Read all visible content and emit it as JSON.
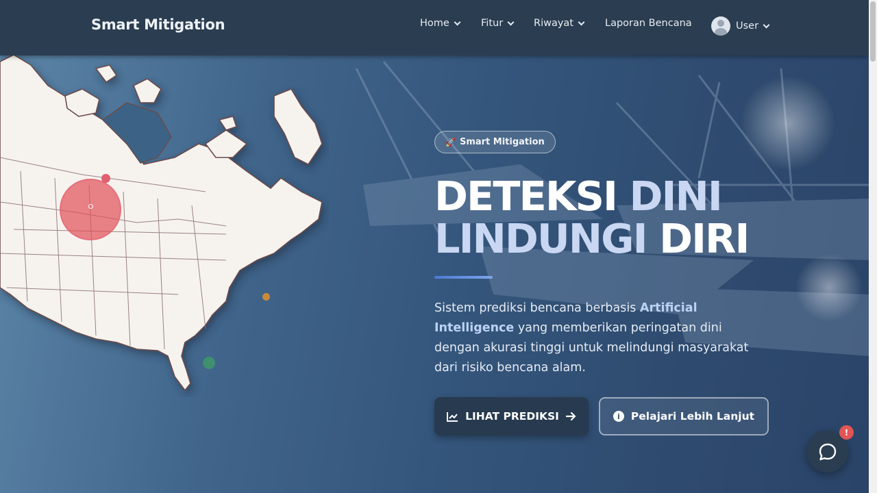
{
  "navbar": {
    "brand": "Smart Mitigation",
    "items": [
      {
        "label": "Home",
        "has_dropdown": true
      },
      {
        "label": "Fitur",
        "has_dropdown": true
      },
      {
        "label": "Riwayat",
        "has_dropdown": true
      },
      {
        "label": "Laporan Bencana",
        "has_dropdown": false
      }
    ],
    "user": {
      "label": "User",
      "icon": "user-avatar-icon"
    }
  },
  "hero": {
    "badge": {
      "icon": "rocket-icon",
      "label": "Smart Mitigation"
    },
    "headline": {
      "line1_a": "DETEKSI",
      "line1_b": "DINI",
      "line2_a": "LINDUNGI",
      "line2_b": "DIRI"
    },
    "description": {
      "part1": "Sistem prediksi bencana berbasis ",
      "highlight": "Artificial Intelligence",
      "part2": " yang memberikan peringatan dini dengan akurasi tinggi untuk melindungi masyarakat dari risiko bencana alam."
    },
    "buttons": {
      "primary": {
        "label": "LIHAT PREDIKSI",
        "icon": "chart-line-icon",
        "trailing_icon": "arrow-right-icon"
      },
      "secondary": {
        "label": "Pelajari Lebih Lanjut",
        "icon": "info-circle-icon"
      }
    }
  },
  "chat": {
    "icon": "chat-bubble-icon",
    "badge": "!"
  },
  "colors": {
    "navbar_bg": "#2b3d50",
    "accent": "#6f96e3",
    "alert_red": "#e25555",
    "primary_button_bg": "#273a4f"
  }
}
